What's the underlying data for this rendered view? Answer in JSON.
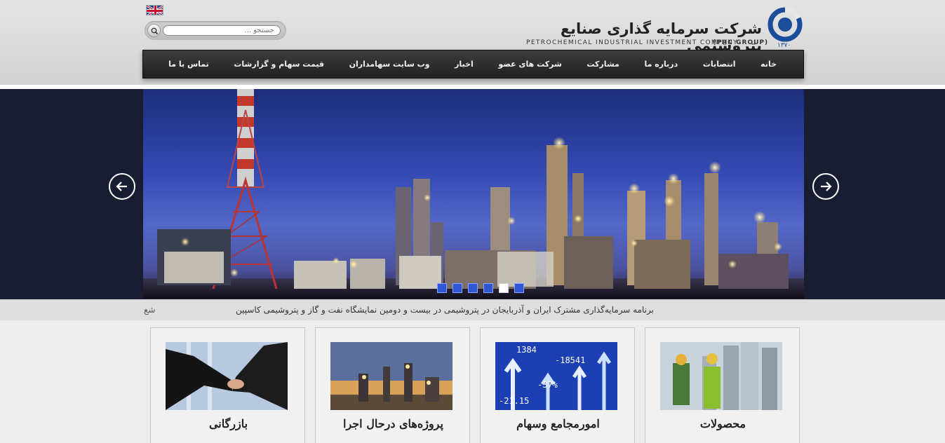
{
  "header": {
    "brand_fa": "شرکت سرمایه گذاری صنایع پتروشیمی",
    "brand_en": "PETROCHEMICAL INDUSTRIAL INVESTMENT COMPANY",
    "brand_group": "(PIIC GROUP)",
    "logo_year": "۱۳۷۰",
    "language_icon": "uk-flag-icon"
  },
  "search": {
    "placeholder": "جستجو ..."
  },
  "nav": {
    "items": [
      {
        "label": "خانه"
      },
      {
        "label": "انتصابات"
      },
      {
        "label": "درباره ما"
      },
      {
        "label": "مشارکت"
      },
      {
        "label": "شرکت های عضو"
      },
      {
        "label": "اخبار"
      },
      {
        "label": "وب سایت سهامداران"
      },
      {
        "label": "قیمت سهام و گزارشات"
      },
      {
        "label": "تماس با ما"
      }
    ]
  },
  "slider": {
    "slide_count": 6,
    "active_index": 4,
    "prev_icon": "arrow-left-icon",
    "next_icon": "arrow-right-icon"
  },
  "ticker": {
    "text": "برنامه سرمایه‌گذاری مشترک ایران و آذربایجان در پتروشیمی در بیست و دومین نمایشگاه نفت و گاز و پتروشیمی کاسپین",
    "edge_text": "شع"
  },
  "cards": [
    {
      "title": "محصولات"
    },
    {
      "title": "امورمجامع وسهام"
    },
    {
      "title": "پروژه‌های درحال اجرا"
    },
    {
      "title": "بازرگانی"
    }
  ],
  "colors": {
    "nav_bg": "#2b2b2b",
    "slider_bg": "#181d32",
    "accent_blue": "#1a4d9a",
    "dot_blue": "#2f56d4"
  }
}
